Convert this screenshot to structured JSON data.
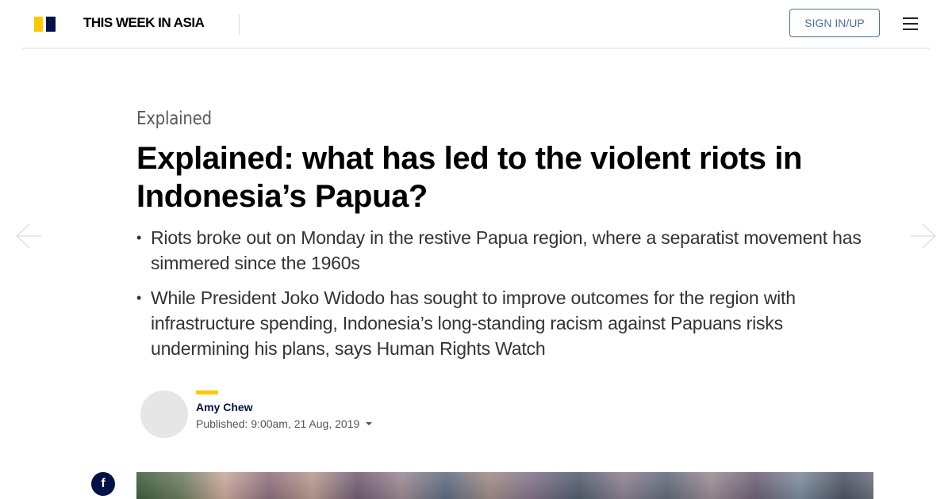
{
  "header": {
    "site_title": "THIS WEEK IN ASIA",
    "sign_in_label": "SIGN IN/UP",
    "brand_colors": {
      "yellow": "#ffc800",
      "navy": "#001246"
    }
  },
  "article": {
    "section": "Explained",
    "headline": "Explained: what has led to the violent riots in Indonesia’s Papua?",
    "summary": [
      "Riots broke out on Monday in the restive Papua region, where a separatist movement has simmered since the 1960s",
      "While President Joko Widodo has sought to improve outcomes for the region with infrastructure spending, Indonesia’s long-standing racism against Papuans risks undermining his plans, says Human Rights Watch"
    ],
    "bullet": "•",
    "author": "Amy Chew",
    "published": "Published: 9:00am, 21 Aug, 2019"
  },
  "social": {
    "facebook_glyph": "f"
  },
  "icons": {
    "menu": "hamburger-menu-icon",
    "prev": "arrow-left-icon",
    "next": "arrow-right-icon",
    "facebook": "facebook-icon"
  }
}
